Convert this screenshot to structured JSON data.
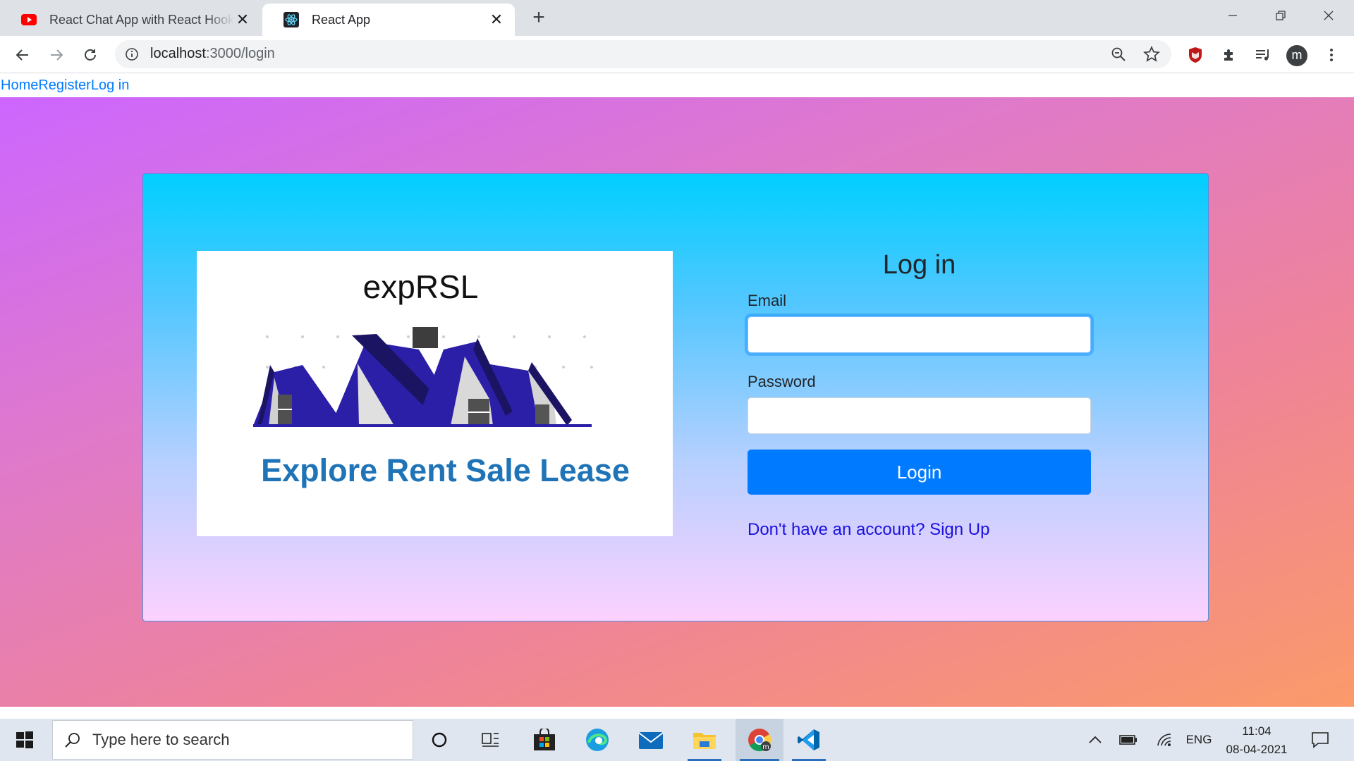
{
  "browser": {
    "tabs": [
      {
        "title": "React Chat App with React Hooks",
        "icon": "youtube-icon",
        "active": false
      },
      {
        "title": "React App",
        "icon": "react-icon",
        "active": true
      }
    ],
    "url_host": "localhost",
    "url_path": ":3000/login",
    "profile_initial": "m"
  },
  "nav": {
    "links": [
      "Home",
      "Register",
      "Log in"
    ]
  },
  "logo": {
    "brand": "expRSL",
    "tagline": "Explore Rent Sale Lease"
  },
  "form": {
    "title": "Log in",
    "email_label": "Email",
    "email_value": "",
    "password_label": "Password",
    "password_value": "",
    "submit_label": "Login",
    "signup_link": "Don't have an account? Sign Up"
  },
  "taskbar": {
    "search_placeholder": "Type here to search",
    "language": "ENG",
    "time": "11:04",
    "date": "08-04-2021"
  },
  "colors": {
    "primary": "#007bff",
    "link": "#1a10e0",
    "tagline": "#1f73b7",
    "house_roof": "#2b1fa8"
  }
}
